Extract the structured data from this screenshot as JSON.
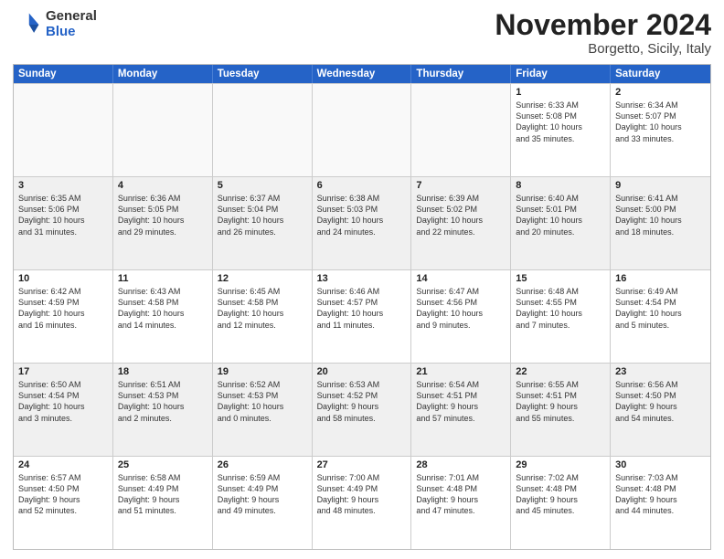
{
  "logo": {
    "general": "General",
    "blue": "Blue"
  },
  "title": "November 2024",
  "location": "Borgetto, Sicily, Italy",
  "header_days": [
    "Sunday",
    "Monday",
    "Tuesday",
    "Wednesday",
    "Thursday",
    "Friday",
    "Saturday"
  ],
  "rows": [
    [
      {
        "day": "",
        "lines": []
      },
      {
        "day": "",
        "lines": []
      },
      {
        "day": "",
        "lines": []
      },
      {
        "day": "",
        "lines": []
      },
      {
        "day": "",
        "lines": []
      },
      {
        "day": "1",
        "lines": [
          "Sunrise: 6:33 AM",
          "Sunset: 5:08 PM",
          "Daylight: 10 hours",
          "and 35 minutes."
        ]
      },
      {
        "day": "2",
        "lines": [
          "Sunrise: 6:34 AM",
          "Sunset: 5:07 PM",
          "Daylight: 10 hours",
          "and 33 minutes."
        ]
      }
    ],
    [
      {
        "day": "3",
        "lines": [
          "Sunrise: 6:35 AM",
          "Sunset: 5:06 PM",
          "Daylight: 10 hours",
          "and 31 minutes."
        ]
      },
      {
        "day": "4",
        "lines": [
          "Sunrise: 6:36 AM",
          "Sunset: 5:05 PM",
          "Daylight: 10 hours",
          "and 29 minutes."
        ]
      },
      {
        "day": "5",
        "lines": [
          "Sunrise: 6:37 AM",
          "Sunset: 5:04 PM",
          "Daylight: 10 hours",
          "and 26 minutes."
        ]
      },
      {
        "day": "6",
        "lines": [
          "Sunrise: 6:38 AM",
          "Sunset: 5:03 PM",
          "Daylight: 10 hours",
          "and 24 minutes."
        ]
      },
      {
        "day": "7",
        "lines": [
          "Sunrise: 6:39 AM",
          "Sunset: 5:02 PM",
          "Daylight: 10 hours",
          "and 22 minutes."
        ]
      },
      {
        "day": "8",
        "lines": [
          "Sunrise: 6:40 AM",
          "Sunset: 5:01 PM",
          "Daylight: 10 hours",
          "and 20 minutes."
        ]
      },
      {
        "day": "9",
        "lines": [
          "Sunrise: 6:41 AM",
          "Sunset: 5:00 PM",
          "Daylight: 10 hours",
          "and 18 minutes."
        ]
      }
    ],
    [
      {
        "day": "10",
        "lines": [
          "Sunrise: 6:42 AM",
          "Sunset: 4:59 PM",
          "Daylight: 10 hours",
          "and 16 minutes."
        ]
      },
      {
        "day": "11",
        "lines": [
          "Sunrise: 6:43 AM",
          "Sunset: 4:58 PM",
          "Daylight: 10 hours",
          "and 14 minutes."
        ]
      },
      {
        "day": "12",
        "lines": [
          "Sunrise: 6:45 AM",
          "Sunset: 4:58 PM",
          "Daylight: 10 hours",
          "and 12 minutes."
        ]
      },
      {
        "day": "13",
        "lines": [
          "Sunrise: 6:46 AM",
          "Sunset: 4:57 PM",
          "Daylight: 10 hours",
          "and 11 minutes."
        ]
      },
      {
        "day": "14",
        "lines": [
          "Sunrise: 6:47 AM",
          "Sunset: 4:56 PM",
          "Daylight: 10 hours",
          "and 9 minutes."
        ]
      },
      {
        "day": "15",
        "lines": [
          "Sunrise: 6:48 AM",
          "Sunset: 4:55 PM",
          "Daylight: 10 hours",
          "and 7 minutes."
        ]
      },
      {
        "day": "16",
        "lines": [
          "Sunrise: 6:49 AM",
          "Sunset: 4:54 PM",
          "Daylight: 10 hours",
          "and 5 minutes."
        ]
      }
    ],
    [
      {
        "day": "17",
        "lines": [
          "Sunrise: 6:50 AM",
          "Sunset: 4:54 PM",
          "Daylight: 10 hours",
          "and 3 minutes."
        ]
      },
      {
        "day": "18",
        "lines": [
          "Sunrise: 6:51 AM",
          "Sunset: 4:53 PM",
          "Daylight: 10 hours",
          "and 2 minutes."
        ]
      },
      {
        "day": "19",
        "lines": [
          "Sunrise: 6:52 AM",
          "Sunset: 4:53 PM",
          "Daylight: 10 hours",
          "and 0 minutes."
        ]
      },
      {
        "day": "20",
        "lines": [
          "Sunrise: 6:53 AM",
          "Sunset: 4:52 PM",
          "Daylight: 9 hours",
          "and 58 minutes."
        ]
      },
      {
        "day": "21",
        "lines": [
          "Sunrise: 6:54 AM",
          "Sunset: 4:51 PM",
          "Daylight: 9 hours",
          "and 57 minutes."
        ]
      },
      {
        "day": "22",
        "lines": [
          "Sunrise: 6:55 AM",
          "Sunset: 4:51 PM",
          "Daylight: 9 hours",
          "and 55 minutes."
        ]
      },
      {
        "day": "23",
        "lines": [
          "Sunrise: 6:56 AM",
          "Sunset: 4:50 PM",
          "Daylight: 9 hours",
          "and 54 minutes."
        ]
      }
    ],
    [
      {
        "day": "24",
        "lines": [
          "Sunrise: 6:57 AM",
          "Sunset: 4:50 PM",
          "Daylight: 9 hours",
          "and 52 minutes."
        ]
      },
      {
        "day": "25",
        "lines": [
          "Sunrise: 6:58 AM",
          "Sunset: 4:49 PM",
          "Daylight: 9 hours",
          "and 51 minutes."
        ]
      },
      {
        "day": "26",
        "lines": [
          "Sunrise: 6:59 AM",
          "Sunset: 4:49 PM",
          "Daylight: 9 hours",
          "and 49 minutes."
        ]
      },
      {
        "day": "27",
        "lines": [
          "Sunrise: 7:00 AM",
          "Sunset: 4:49 PM",
          "Daylight: 9 hours",
          "and 48 minutes."
        ]
      },
      {
        "day": "28",
        "lines": [
          "Sunrise: 7:01 AM",
          "Sunset: 4:48 PM",
          "Daylight: 9 hours",
          "and 47 minutes."
        ]
      },
      {
        "day": "29",
        "lines": [
          "Sunrise: 7:02 AM",
          "Sunset: 4:48 PM",
          "Daylight: 9 hours",
          "and 45 minutes."
        ]
      },
      {
        "day": "30",
        "lines": [
          "Sunrise: 7:03 AM",
          "Sunset: 4:48 PM",
          "Daylight: 9 hours",
          "and 44 minutes."
        ]
      }
    ]
  ]
}
